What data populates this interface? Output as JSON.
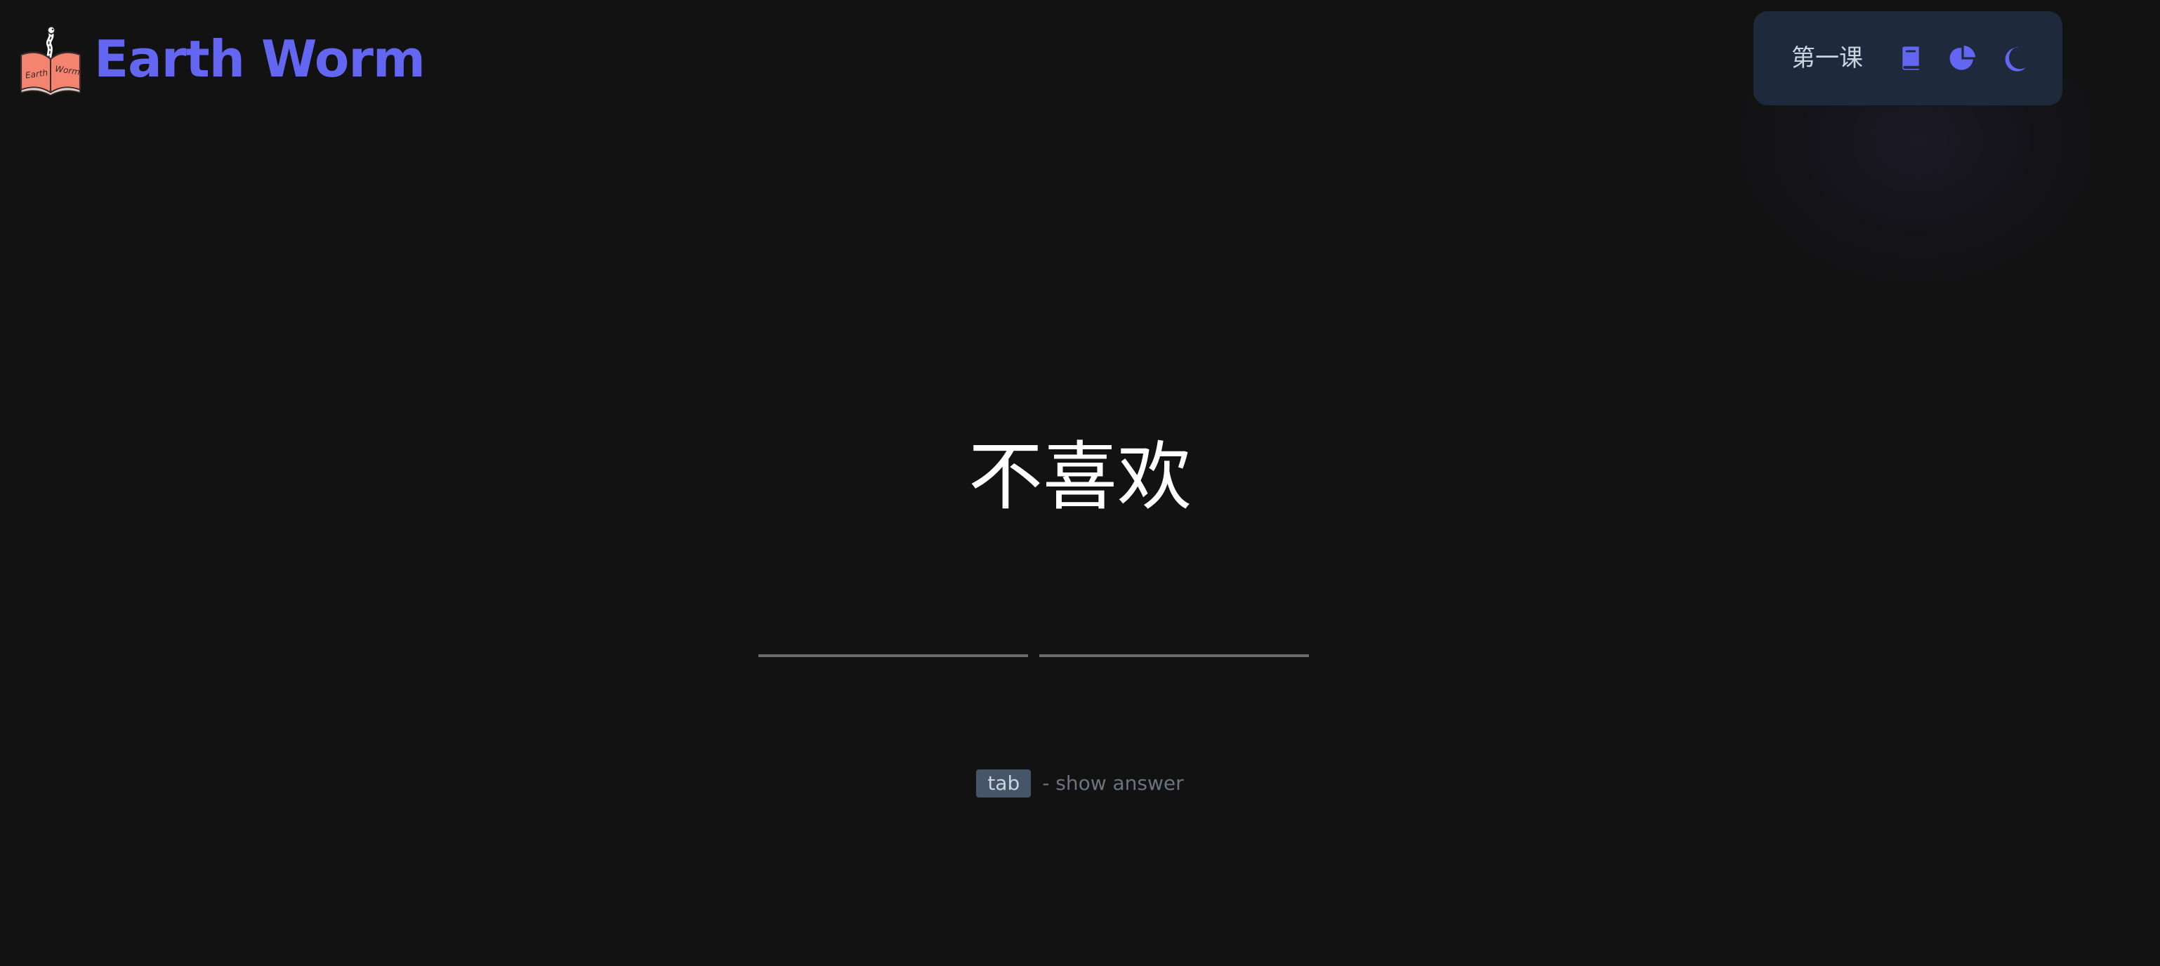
{
  "app": {
    "title": "Earth Worm",
    "logo": {
      "icon": "earthworm-book-logo",
      "book_left_text": "Earth",
      "book_right_text": "Worm"
    }
  },
  "header": {
    "lesson_name": "第一课",
    "icons": {
      "book": "book-icon",
      "progress": "pie-chart-icon",
      "theme": "moon-icon"
    }
  },
  "question": {
    "text": "不喜欢"
  },
  "answer": {
    "inputs": [
      {
        "value": "",
        "placeholder": ""
      },
      {
        "value": "",
        "placeholder": ""
      }
    ]
  },
  "hint": {
    "key": "tab",
    "text": "- show answer"
  },
  "colors": {
    "background": "#121212",
    "accent": "#6366f1",
    "panel_bg": "#1e293b",
    "lesson_text": "#cbd5e1",
    "question_text": "#ffffff",
    "kbd_bg": "#475569",
    "kbd_text": "#cbd5e1",
    "hint_text": "#6b7280",
    "logo_book": "#f4846f"
  }
}
